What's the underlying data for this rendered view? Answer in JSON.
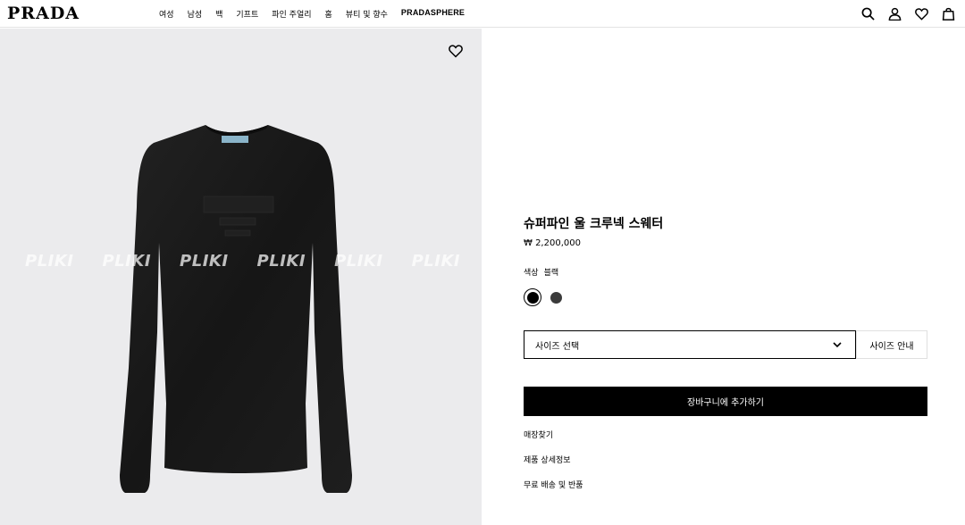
{
  "header": {
    "logo": "PRADA",
    "nav": [
      "여성",
      "남성",
      "백",
      "기프트",
      "파인 주얼리",
      "홈",
      "뷰티 및 향수",
      "PRADASPHERE"
    ],
    "icons": [
      "search-icon",
      "account-icon",
      "wishlist-icon",
      "bag-icon"
    ]
  },
  "image": {
    "watermark": [
      "PLIKI",
      "PLIKI",
      "PLIKI",
      "PLIKI",
      "PLIKI",
      "PLIKI"
    ],
    "sweater_color": "#1a1a1a",
    "background_color": "#ebebed"
  },
  "product": {
    "title": "슈퍼파인 울 크루넥 스웨터",
    "price": "₩ 2,200,000",
    "color_label": "색상",
    "color_value": "블랙",
    "swatches": [
      {
        "name": "블랙",
        "hex": "#000000",
        "selected": true
      },
      {
        "name": "dark-grey",
        "hex": "#3b3b3b",
        "selected": false
      }
    ],
    "size_select_label": "사이즈 선택",
    "size_guide_label": "사이즈 안내",
    "add_to_cart_label": "장바구니에 추가하기",
    "links": [
      "매장찾기",
      "제품 상세정보",
      "무료 배송 및 반품"
    ]
  }
}
